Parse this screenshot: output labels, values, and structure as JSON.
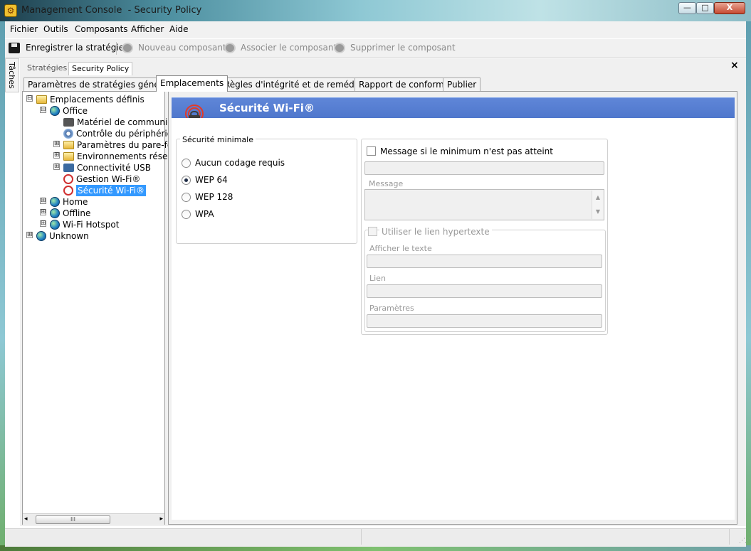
{
  "window": {
    "title": "Management Console  - Security Policy",
    "min": "—",
    "max": "□",
    "close": "X"
  },
  "menu": [
    "Fichier",
    "Outils",
    "Composants",
    "Afficher",
    "Aide"
  ],
  "toolbar": {
    "save": "Enregistrer la stratégie",
    "new_component": "Nouveau composant",
    "associate_component": "Associer le composant",
    "delete_component": "Supprimer le composant"
  },
  "side_panel": {
    "label": "Tâches"
  },
  "outer_tabs": [
    "Stratégies",
    "Security Policy"
  ],
  "close_button": "×",
  "inner_tabs": [
    "Paramètres de stratégies généraux",
    "Emplacements",
    "Règles d'intégrité et de remédiation",
    "Rapport de conformité",
    "Publier"
  ],
  "tree": [
    {
      "label": "Emplacements définis",
      "icon": "folder-icon",
      "expander": "⊟"
    },
    {
      "label": "Office",
      "icon": "globe-icon",
      "expander": "⊟"
    },
    {
      "label": "Matériel de communica",
      "icon": "plug-icon",
      "expander": ""
    },
    {
      "label": "Contrôle du périphériqu",
      "icon": "cog-icon",
      "expander": ""
    },
    {
      "label": "Paramètres du pare-fe",
      "icon": "folder-icon",
      "expander": "⊞"
    },
    {
      "label": "Environnements résea",
      "icon": "folder-icon",
      "expander": "⊞"
    },
    {
      "label": "Connectivité USB",
      "icon": "usb-icon",
      "expander": "⊞"
    },
    {
      "label": "Gestion Wi-Fi®",
      "icon": "wifi-icon",
      "expander": ""
    },
    {
      "label": "Sécurité Wi-Fi®",
      "icon": "wifi-lock-icon",
      "expander": ""
    },
    {
      "label": "Home",
      "icon": "globe-icon",
      "expander": "⊞"
    },
    {
      "label": "Offline",
      "icon": "globe-icon",
      "expander": "⊞"
    },
    {
      "label": "Wi-Fi Hotspot",
      "icon": "globe-icon",
      "expander": "⊞"
    },
    {
      "label": "Unknown",
      "icon": "globe-icon",
      "expander": "⊞"
    }
  ],
  "scroll": {
    "left": "◂",
    "right": "▸",
    "thumb": "III",
    "up": "▲",
    "down": "▼"
  },
  "panel": {
    "title": "Sécurité Wi-Fi®",
    "min_security_label": "Sécurité minimale",
    "options": [
      "Aucun codage requis",
      "WEP 64",
      "WEP 128",
      "WPA"
    ],
    "selected": "WEP 64",
    "message_checkbox": "Message si le minimum n'est pas atteint",
    "message_label": "Message",
    "hyperlink_checkbox": "Utiliser le lien hypertexte",
    "display_text_label": "Afficher le texte",
    "link_label": "Lien",
    "params_label": "Paramètres"
  },
  "colors": {
    "header_blue": "#5a80d4",
    "selection": "#3399ff"
  }
}
